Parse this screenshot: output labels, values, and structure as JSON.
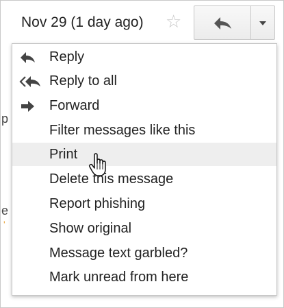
{
  "header": {
    "date": "Nov 29 (1 day ago)",
    "star_icon": "star-outline-icon",
    "reply_icon": "reply-arrow-icon",
    "more_icon": "dropdown-triangle-icon"
  },
  "menu": {
    "items": [
      {
        "label": "Reply",
        "icon": "reply-icon"
      },
      {
        "label": "Reply to all",
        "icon": "reply-all-icon"
      },
      {
        "label": "Forward",
        "icon": "forward-icon"
      },
      {
        "label": "Filter messages like this"
      },
      {
        "label": "Print",
        "highlighted": true
      },
      {
        "label": "Delete this message"
      },
      {
        "label": "Report phishing"
      },
      {
        "label": "Show original"
      },
      {
        "label": "Message text garbled?"
      },
      {
        "label": "Mark unread from here"
      }
    ]
  },
  "colors": {
    "highlight": "#eeeeee",
    "text": "#222222",
    "icon": "#444444",
    "star": "#c6c6c6"
  }
}
